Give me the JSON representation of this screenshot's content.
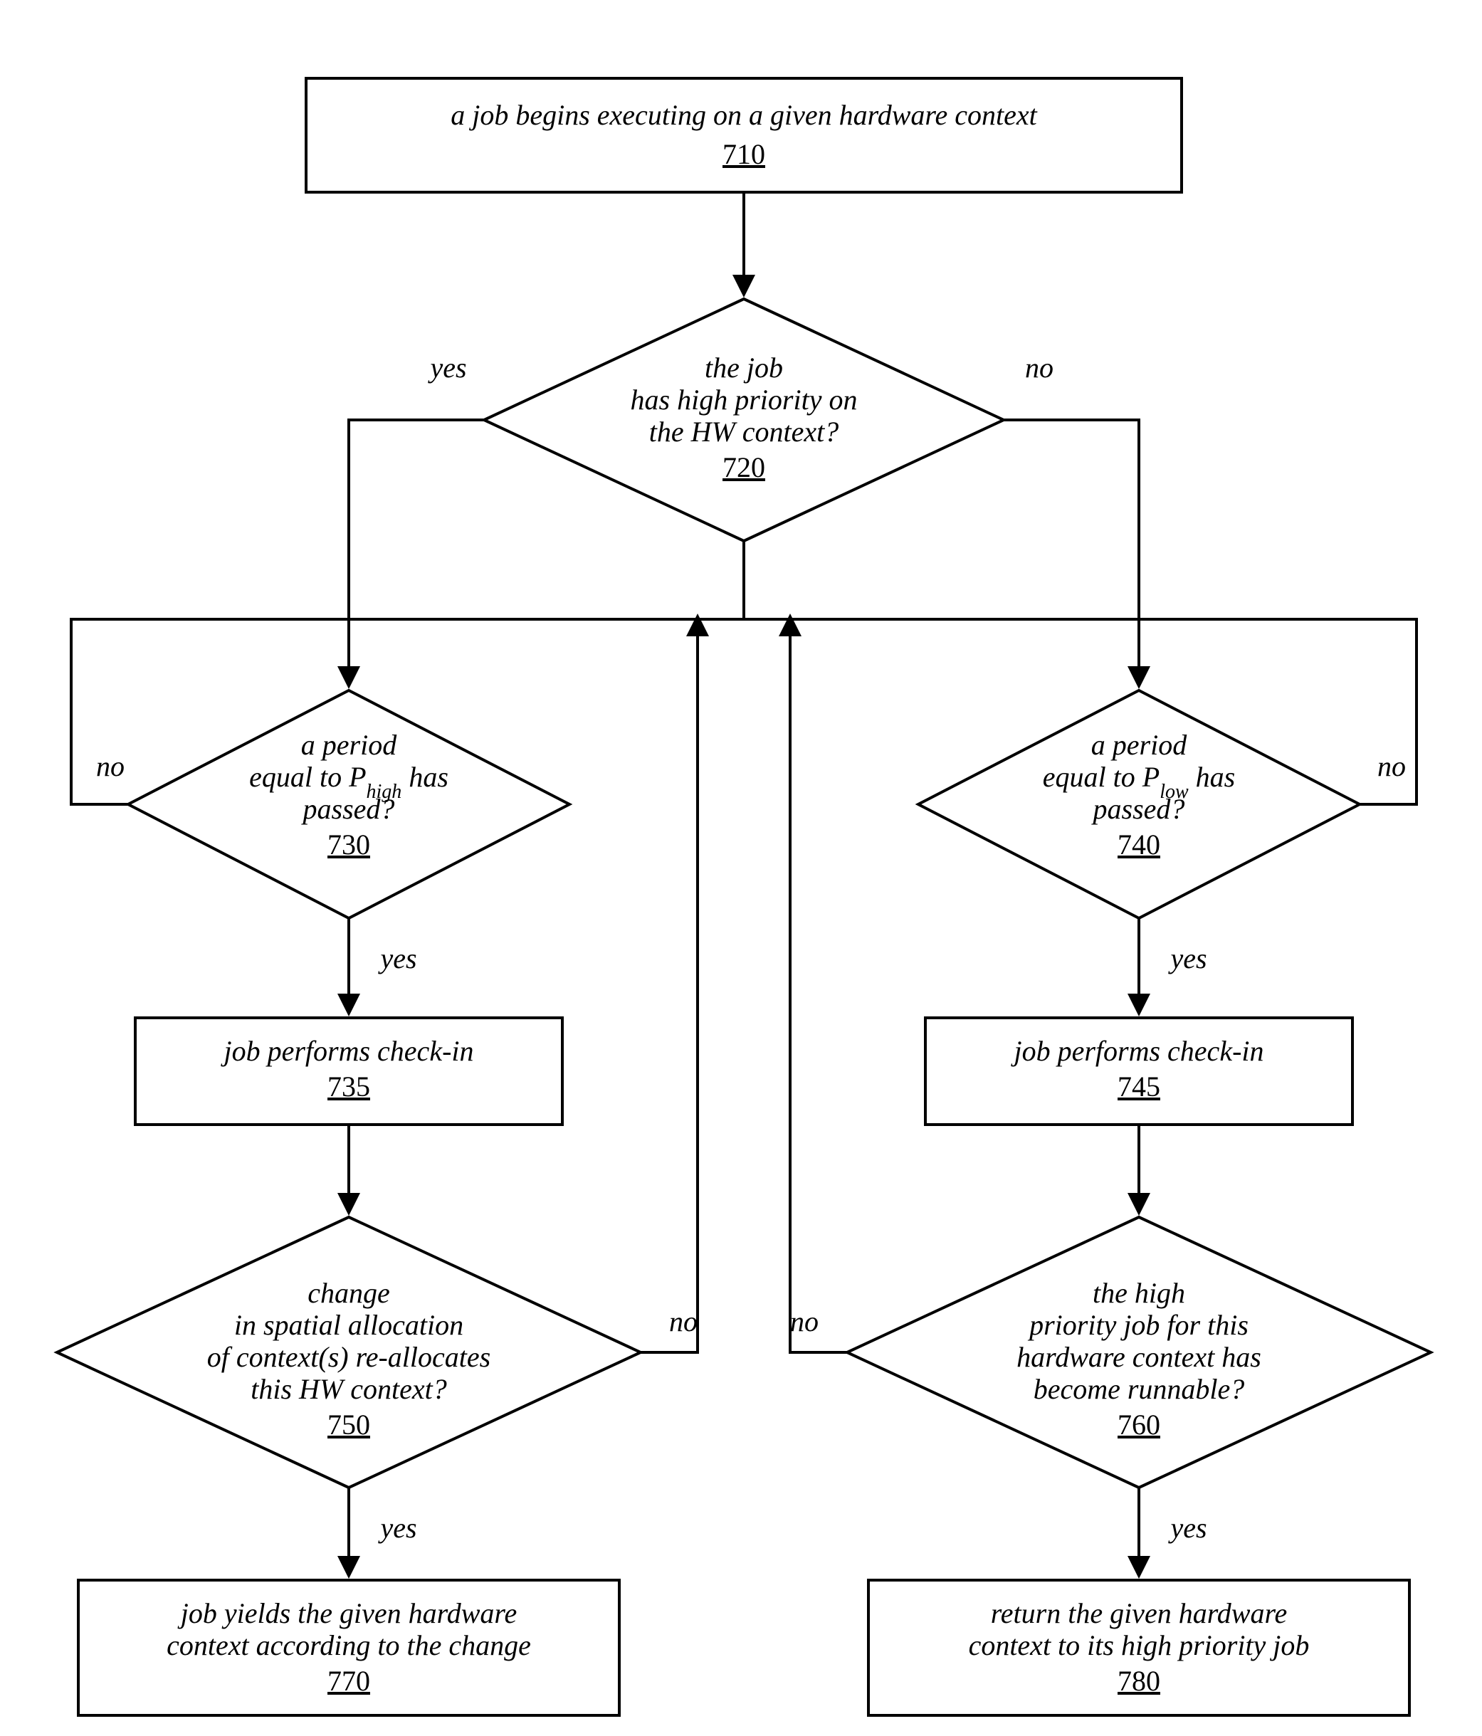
{
  "nodes": {
    "n710": {
      "text": "a job begins executing on a given hardware context",
      "ref": "710"
    },
    "n720": {
      "l1": "the job",
      "l2": "has high priority on",
      "l3": "the HW context?",
      "ref": "720"
    },
    "n730": {
      "l1": "a period",
      "l2_a": "equal to P",
      "l2_sub": "high",
      "l2_b": " has",
      "l3": "passed?",
      "ref": "730"
    },
    "n735": {
      "text": "job performs check-in",
      "ref": "735"
    },
    "n740": {
      "l1": "a period",
      "l2_a": "equal to P",
      "l2_sub": "low",
      "l2_b": " has",
      "l3": "passed?",
      "ref": "740"
    },
    "n745": {
      "text": "job performs check-in",
      "ref": "745"
    },
    "n750": {
      "l1": "change",
      "l2": "in spatial allocation",
      "l3": "of context(s) re-allocates",
      "l4": "this HW context?",
      "ref": "750"
    },
    "n760": {
      "l1": "the high",
      "l2": "priority job for this",
      "l3": "hardware context has",
      "l4": "become runnable?",
      "ref": "760"
    },
    "n770": {
      "l1": "job yields the given hardware",
      "l2": "context according to the change",
      "ref": "770"
    },
    "n780": {
      "l1": "return the given hardware",
      "l2": "context to its high priority job",
      "ref": "780"
    }
  },
  "labels": {
    "yes": "yes",
    "no": "no"
  }
}
